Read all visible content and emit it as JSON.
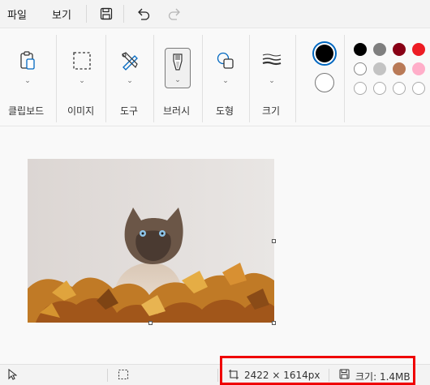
{
  "menubar": {
    "file": "파일",
    "view": "보기"
  },
  "ribbon": {
    "clipboard": "클립보드",
    "image": "이미지",
    "tools": "도구",
    "brushes": "브러시",
    "shapes": "도형",
    "size": "크기",
    "colors": {
      "primary": "#000000",
      "secondary": "#ffffff",
      "row1": [
        "#000000",
        "#7f7f7f",
        "#880015",
        "#ed1c24"
      ],
      "row2": [
        "#ffffff",
        "#c3c3c3",
        "#b97a57",
        "#ffaec9"
      ],
      "row3": [
        "#ffffff",
        "#ffffff",
        "#ffffff",
        "#ffffff"
      ]
    }
  },
  "statusbar": {
    "dimensions": "2422 × 1614px",
    "size": "크기: 1.4MB"
  }
}
